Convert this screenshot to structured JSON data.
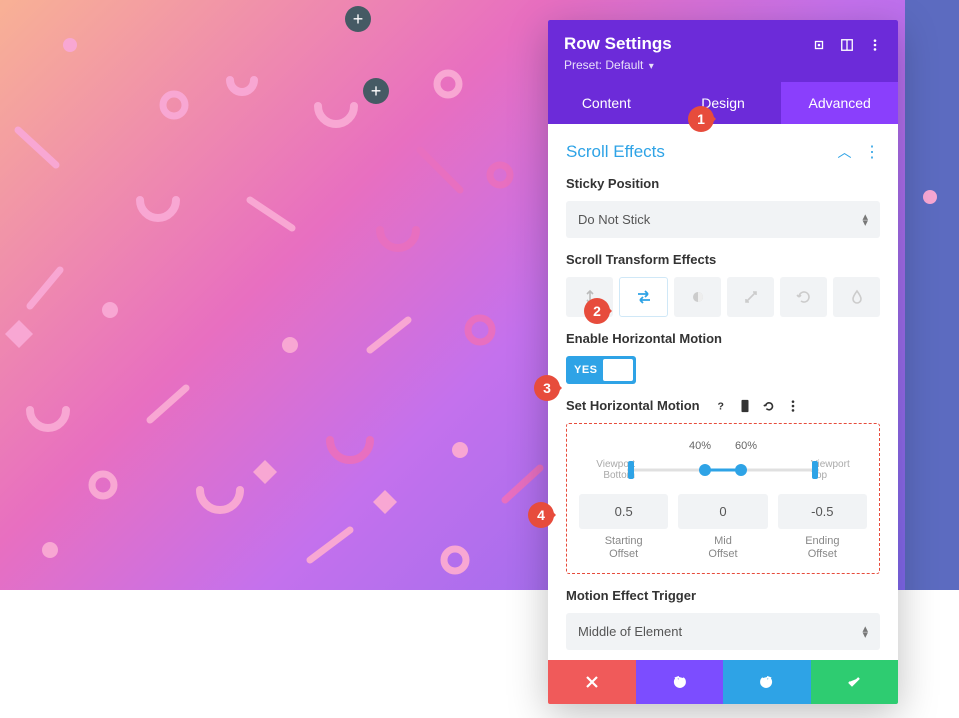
{
  "panel": {
    "title": "Row Settings",
    "preset_prefix": "Preset:",
    "preset_value": "Default",
    "tabs": {
      "content": "Content",
      "design": "Design",
      "advanced": "Advanced"
    }
  },
  "section": {
    "title": "Scroll Effects",
    "sticky": {
      "label": "Sticky Position",
      "value": "Do Not Stick"
    },
    "transform": {
      "label": "Scroll Transform Effects"
    },
    "horizontal": {
      "label": "Enable Horizontal Motion",
      "toggle": "YES"
    },
    "motion": {
      "label": "Set Horizontal Motion",
      "percent_left": "40%",
      "percent_right": "60%",
      "viewport_bottom_a": "Viewport",
      "viewport_bottom_b": "Bottom",
      "viewport_top_a": "Viewport",
      "viewport_top_b": "Top",
      "start_value": "0.5",
      "mid_value": "0",
      "end_value": "-0.5",
      "start_label_a": "Starting",
      "start_label_b": "Offset",
      "mid_label_a": "Mid",
      "mid_label_b": "Offset",
      "end_label_a": "Ending",
      "end_label_b": "Offset"
    },
    "trigger": {
      "label": "Motion Effect Trigger",
      "value": "Middle of Element"
    }
  },
  "markers": {
    "m1": "1",
    "m2": "2",
    "m3": "3",
    "m4": "4"
  },
  "add_glyph": "+"
}
